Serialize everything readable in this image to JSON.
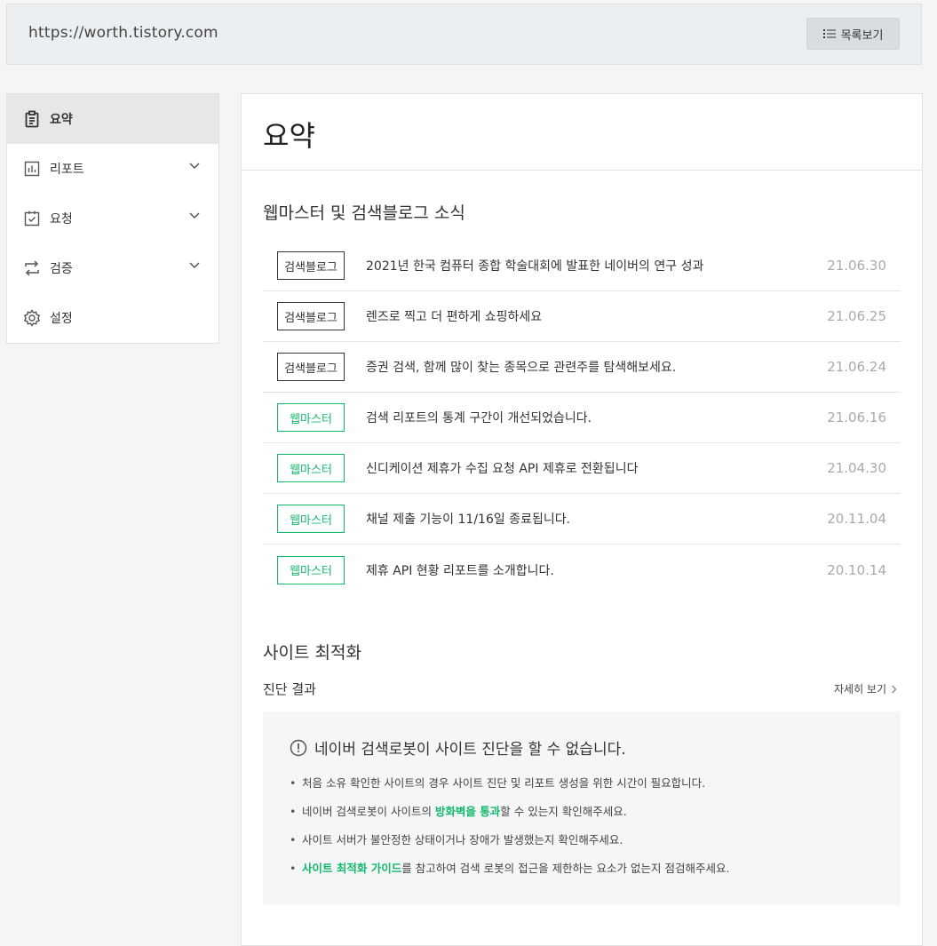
{
  "header": {
    "url": "https://worth.tistory.com",
    "list_button_label": "목록보기"
  },
  "sidebar": {
    "items": [
      {
        "label": "요약",
        "active": true
      },
      {
        "label": "리포트"
      },
      {
        "label": "요청"
      },
      {
        "label": "검증"
      },
      {
        "label": "설정"
      }
    ]
  },
  "main": {
    "title": "요약",
    "news_section_title": "웹마스터 및 검색블로그 소식",
    "news": [
      {
        "tag": "검색블로그",
        "text": "2021년 한국 컴퓨터 종합 학술대회에 발표한 네이버의 연구 성과",
        "date": "21.06.30"
      },
      {
        "tag": "검색블로그",
        "text": "렌즈로 찍고 더 편하게 쇼핑하세요",
        "date": "21.06.25"
      },
      {
        "tag": "검색블로그",
        "text": "증권 검색, 함께 많이 찾는 종목으로 관련주를 탐색해보세요.",
        "date": "21.06.24"
      },
      {
        "tag": "웹마스터",
        "text": "검색 리포트의 통계 구간이 개선되었습니다.",
        "date": "21.06.16"
      },
      {
        "tag": "웹마스터",
        "text": "신디케이션 제휴가 수집 요청 API 제휴로 전환됩니다",
        "date": "21.04.30"
      },
      {
        "tag": "웹마스터",
        "text": "채널 제출 기능이 11/16일 종료됩니다.",
        "date": "20.11.04"
      },
      {
        "tag": "웹마스터",
        "text": "제휴 API 현황 리포트를 소개합니다.",
        "date": "20.10.14"
      }
    ],
    "optimization_title": "사이트 최적화",
    "diagnosis_label": "진단 결과",
    "detail_link": "자세히 보기",
    "diag_message": "네이버 검색로봇이 사이트 진단을 할 수 없습니다.",
    "diag_items": [
      {
        "pre": "처음 소유 확인한 사이트의 경우 사이트 진단 및 리포트 생성을 위한 시간이 필요합니다.",
        "link": "",
        "post": ""
      },
      {
        "pre": "네이버 검색로봇이 사이트의 ",
        "link": "방화벽을 통과",
        "post": "할 수 있는지 확인해주세요."
      },
      {
        "pre": "사이트 서버가 불안정한 상태이거나 장애가 발생했는지 확인해주세요.",
        "link": "",
        "post": ""
      },
      {
        "pre": "",
        "link": "사이트 최적화 가이드",
        "post": "를 참고하여 검색 로봇의 접근을 제한하는 요소가 없는지 점검해주세요."
      }
    ]
  },
  "colors": {
    "accent_green": "#14b86b",
    "date_gray": "#aaaaaa"
  }
}
